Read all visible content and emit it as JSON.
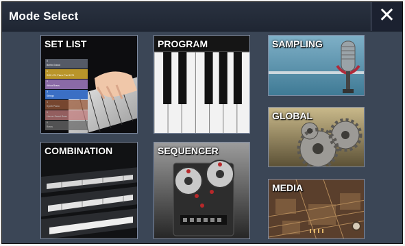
{
  "window": {
    "title": "Mode Select",
    "close_label": "✕"
  },
  "modes": {
    "set_list": "SET LIST",
    "program": "PROGRAM",
    "sampling": "SAMPLING",
    "global": "GLOBAL",
    "combination": "COMBINATION",
    "sequencer": "SEQUENCER",
    "media": "MEDIA"
  },
  "set_list_preview": [
    {
      "num": "0",
      "name": "Berlin Grand",
      "color": "#555a66"
    },
    {
      "num": "1",
      "name": "SGX / EL Piano Pad 1971",
      "color": "#b9952a"
    },
    {
      "num": "2",
      "name": "Africa Brass",
      "color": "#8a6aa6"
    },
    {
      "num": "3",
      "name": "Strings",
      "color": "#3b6fc4"
    },
    {
      "num": "4",
      "name": "Synth Piano",
      "color": "#9a5a3a"
    },
    {
      "num": "5",
      "name": "Harmo Sweet Bass",
      "color": "#c07a7a"
    },
    {
      "num": "6",
      "name": "Brass",
      "color": "#6a6a6a"
    }
  ],
  "colors": {
    "background": "#3b4656",
    "titlebar": "#1f2633",
    "tile_border": "#7e8aa0"
  }
}
